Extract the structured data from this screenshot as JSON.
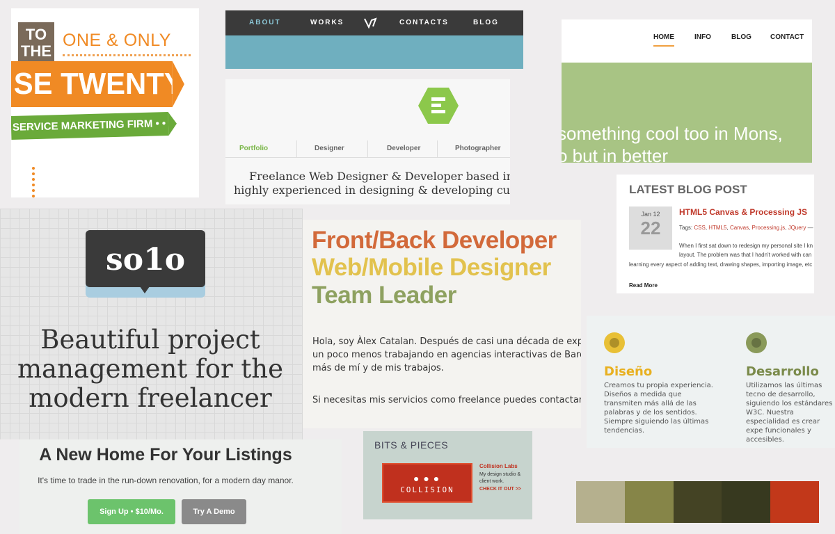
{
  "panel1": {
    "to_the": "TO THE",
    "one_and_only": "ONE & ONLY",
    "banner": "SE TWENTY ONE",
    "ribbon": "SERVICE MARKETING FIRM • • •"
  },
  "panel2": {
    "nav": [
      "ABOUT",
      "WORKS",
      "CONTACTS",
      "BLOG"
    ]
  },
  "panel3": {
    "tabs": [
      "Portfolio",
      "Designer",
      "Developer",
      "Photographer"
    ],
    "line1": "Freelance Web Designer & Developer based in M",
    "line2": "highly experienced in designing & developing custo"
  },
  "panel4": {
    "nav": [
      "HOME",
      "INFO",
      "BLOG",
      "CONTACT"
    ],
    "line1": "something cool too in Mons,",
    "line2": "o but in better"
  },
  "panel5": {
    "heading": "LATEST BLOG POST",
    "month": "Jan 12",
    "day": "22",
    "title": "HTML5 Canvas & Processing JS",
    "tags_label": "Tags:",
    "tags": [
      "CSS",
      "HTML5",
      "Canvas",
      "Processing.js",
      "JQuery"
    ],
    "body1": "When I first sat down to redesign my personal site I kn",
    "body2": "layout. The problem was that I hadn't worked with can",
    "body3": "learning every aspect of adding text, drawing shapes, importing image, etc",
    "read_more": "Read More"
  },
  "panel6": {
    "logo": "so1o",
    "headline1": "Beautiful project",
    "headline2": "management for the",
    "headline3": "modern freelancer"
  },
  "panel7": {
    "line1": "Front/Back Developer",
    "line2": "Web/Mobile Designer",
    "line3": "Team Leader",
    "para1": "Hola, soy Àlex Catalan. Después de casi una década de experienc",
    "para2": "un poco menos trabajando en agencias interactivas de Barcelona",
    "para3": "más de mí y de mis trabajos.",
    "para4": "Si necesitas mis servicios como freelance puedes contactarme ",
    "link": "a"
  },
  "panel8": {
    "col1_title": "Diseño",
    "col1_text": "Creamos tu propia experiencia. Diseños a medida que transmiten más allá de las palabras y de los sentidos. Siempre siguiendo las últimas tendencias.",
    "col2_title": "Desarrollo",
    "col2_text": "Utilizamos las últimas tecno de desarrollo, siguiendo los estándares W3C. Nuestra especialidad es crear expe funcionales y accesibles.",
    "col1_color": "#e8c036",
    "col2_color": "#8a9a5a"
  },
  "panel9": {
    "heading": "A New Home For Your Listings",
    "subtext": "It's time to trade in the run-down renovation, for a modern day manor.",
    "signup": "Sign Up • $10/Mo.",
    "demo": "Try A Demo"
  },
  "panel10": {
    "heading": "BITS & PIECES",
    "dots": "● ● ●",
    "banner": "COLLISION",
    "card_title": "Collision Labs",
    "card_desc": "My design studio & client work.",
    "card_link": "CHECK IT OUT >>"
  },
  "palette": [
    "#b5b08e",
    "#868548",
    "#444324",
    "#37391f",
    "#c2381a"
  ]
}
